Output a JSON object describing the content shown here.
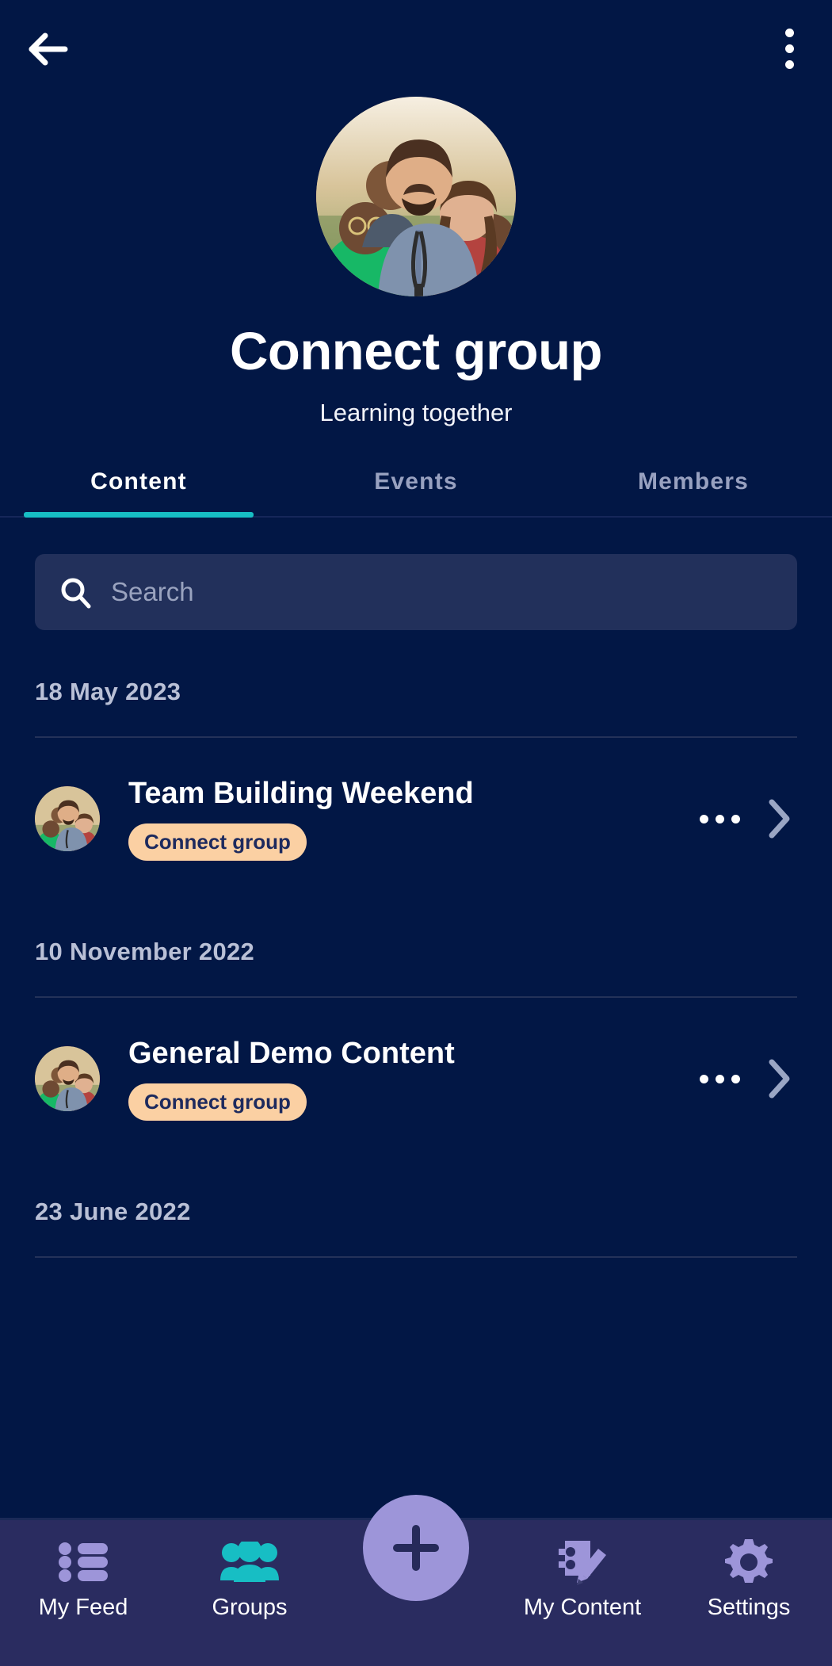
{
  "theme": {
    "background": "#021745",
    "search_background": "#22305b",
    "accent_teal": "#17bec4",
    "chip_background": "#fbd0a3",
    "chip_text": "#1d2a5e",
    "nav_background": "#2a2c60",
    "nav_icon_inactive": "#9d95d9",
    "nav_icon_active": "#17bec4",
    "fab_background": "#9d95d9"
  },
  "topbar": {
    "back_icon": "arrow-left-icon",
    "menu_icon": "kebab-menu-icon"
  },
  "header": {
    "avatar_alt": "group-photo",
    "title": "Connect group",
    "subtitle": "Learning together"
  },
  "tabs": [
    {
      "label": "Content",
      "active": true
    },
    {
      "label": "Events",
      "active": false
    },
    {
      "label": "Members",
      "active": false
    }
  ],
  "search": {
    "icon": "search-icon",
    "placeholder": "Search",
    "value": ""
  },
  "sections": [
    {
      "date": "18 May 2023",
      "items": [
        {
          "title": "Team Building Weekend",
          "chip": "Connect group",
          "more_icon": "more-horizontal-icon",
          "chevron_icon": "chevron-right-icon"
        }
      ]
    },
    {
      "date": "10 November 2022",
      "items": [
        {
          "title": "General Demo Content",
          "chip": "Connect group",
          "more_icon": "more-horizontal-icon",
          "chevron_icon": "chevron-right-icon"
        }
      ]
    },
    {
      "date": "23 June 2022",
      "items": []
    }
  ],
  "bottom_nav": {
    "items": [
      {
        "label": "My Feed",
        "icon": "list-icon",
        "active": false
      },
      {
        "label": "Groups",
        "icon": "people-icon",
        "active": true
      },
      {
        "label": "My Content",
        "icon": "notebook-pencil-icon",
        "active": false
      },
      {
        "label": "Settings",
        "icon": "gear-icon",
        "active": false
      }
    ],
    "fab": {
      "icon": "plus-icon",
      "label": ""
    }
  }
}
